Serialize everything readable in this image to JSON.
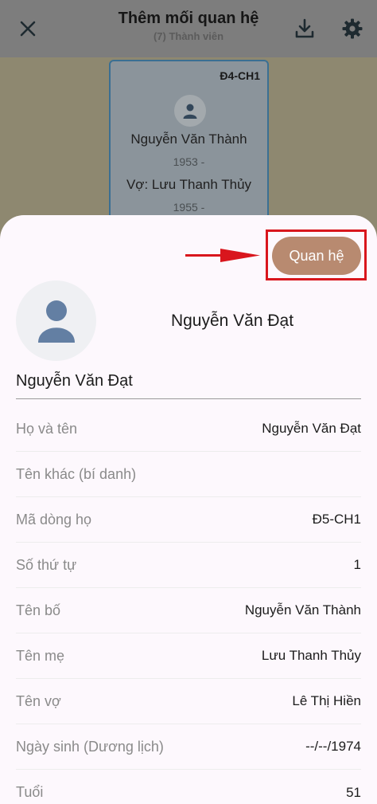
{
  "header": {
    "title": "Thêm mối quan hệ",
    "subtitle": "(7) Thành viên",
    "icons": {
      "close": "close-icon",
      "download": "download-icon",
      "settings": "gear-icon"
    }
  },
  "member_card": {
    "code": "Đ4-CH1",
    "name": "Nguyễn Văn Thành",
    "years": "1953 -",
    "spouse": "Vợ: Lưu Thanh Thủy",
    "spouse_years": "1955 -"
  },
  "sheet": {
    "relation_button": "Quan hệ",
    "profile_name": "Nguyễn Văn Đạt",
    "name_field_value": "Nguyễn Văn Đạt",
    "details": [
      {
        "label": "Họ và tên",
        "value": "Nguyễn Văn Đạt"
      },
      {
        "label": "Tên khác (bí danh)",
        "value": ""
      },
      {
        "label": "Mã dòng họ",
        "value": "Đ5-CH1"
      },
      {
        "label": "Số thứ tự",
        "value": "1"
      },
      {
        "label": "Tên bố",
        "value": "Nguyễn Văn Thành"
      },
      {
        "label": "Tên mẹ",
        "value": "Lưu Thanh Thủy"
      },
      {
        "label": "Tên vợ",
        "value": "Lê Thị Hiền"
      },
      {
        "label": "Ngày sinh (Dương lịch)",
        "value": "--/--/1974"
      },
      {
        "label": "Tuổi",
        "value": "51"
      }
    ]
  },
  "colors": {
    "accent_button": "#b88a70",
    "highlight_box": "#d9161d",
    "arrow": "#d9161d",
    "card_border": "#3a6f93"
  }
}
